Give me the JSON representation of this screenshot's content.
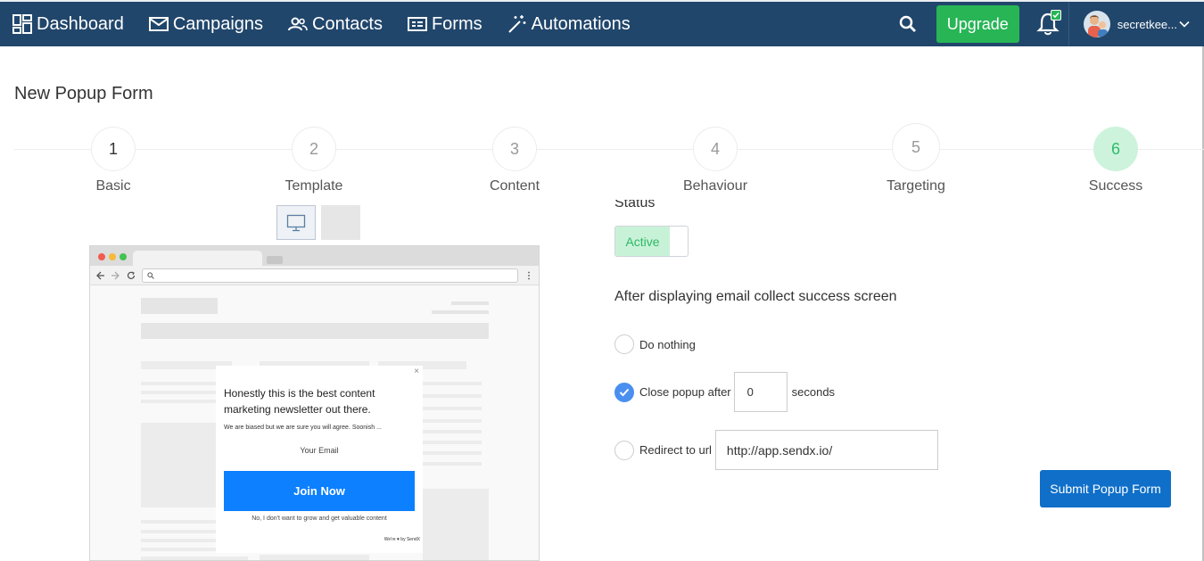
{
  "nav": {
    "items": [
      {
        "label": "Dashboard",
        "icon": "dashboard-icon"
      },
      {
        "label": "Campaigns",
        "icon": "envelope-icon"
      },
      {
        "label": "Contacts",
        "icon": "users-icon"
      },
      {
        "label": "Forms",
        "icon": "form-icon"
      },
      {
        "label": "Automations",
        "icon": "magic-wand-icon"
      }
    ],
    "upgrade_label": "Upgrade",
    "username": "secretkee..."
  },
  "page_title": "New Popup Form",
  "steps": [
    {
      "number": "1",
      "label": "Basic"
    },
    {
      "number": "2",
      "label": "Template"
    },
    {
      "number": "3",
      "label": "Content"
    },
    {
      "number": "4",
      "label": "Behaviour"
    },
    {
      "number": "5",
      "label": "Targeting"
    },
    {
      "number": "6",
      "label": "Success"
    }
  ],
  "preview": {
    "headline": "Honestly this is the best content marketing newsletter out there.",
    "subtext": "We are biased but we are sure you will agree. Soonish ...",
    "email_placeholder": "Your Email",
    "join_label": "Join Now",
    "decline_text": "No, I don't want to grow and get valuable content",
    "branding": "We're ♥ by SendX",
    "close_symbol": "×"
  },
  "settings": {
    "status_label": "Status",
    "status_value": "Active",
    "after_text": "After displaying email collect success screen",
    "option_nothing": "Do nothing",
    "option_close": "Close popup after",
    "close_seconds": "0",
    "seconds_label": "seconds",
    "option_redirect": "Redirect to url",
    "redirect_url": "http://app.sendx.io/",
    "selected_option": "close"
  },
  "submit_label": "Submit Popup Form",
  "colors": {
    "nav_bg": "#21466b",
    "upgrade": "#27b556",
    "primary": "#0f6fc9",
    "active_step": "#cdf3dd",
    "radio_checked": "#4a8ff0"
  }
}
